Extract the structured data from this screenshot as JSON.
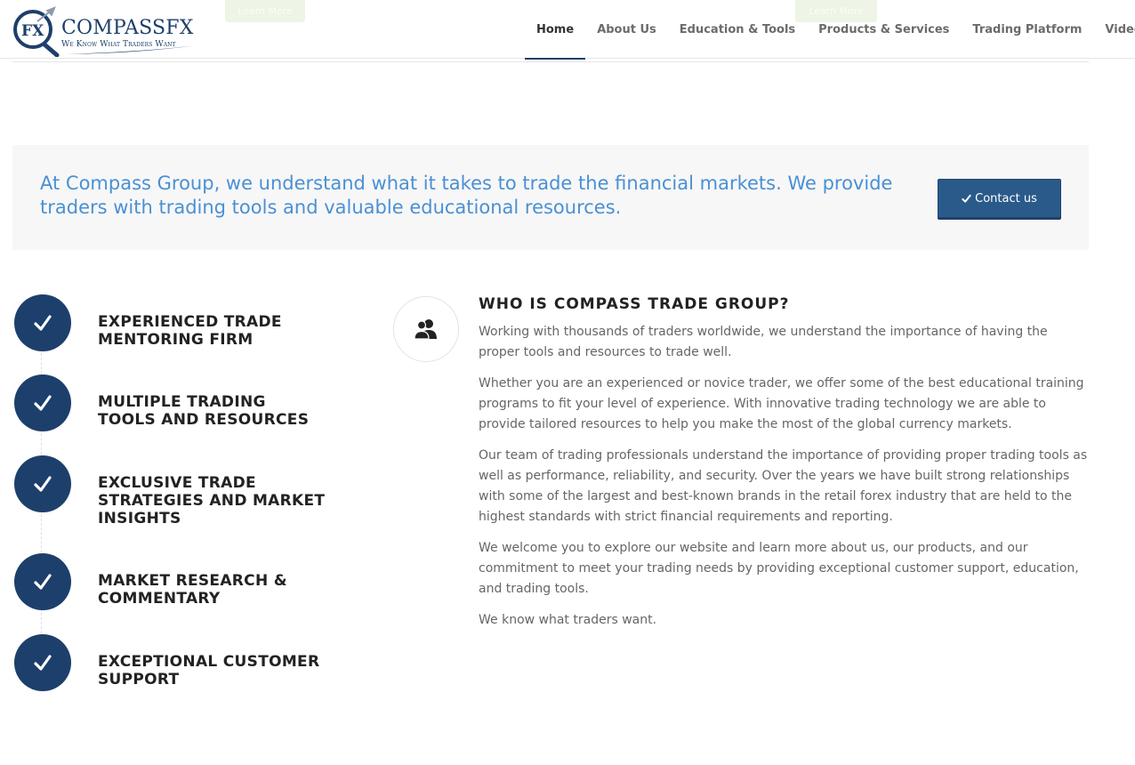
{
  "header": {
    "logo": {
      "mark_text": "FX",
      "name_part1": "Compass",
      "name_part2": "FX",
      "tagline": "We Know What Traders Want"
    },
    "ghost_buttons": [
      "Learn More",
      "Learn More"
    ],
    "nav": [
      {
        "label": "Home",
        "active": true
      },
      {
        "label": "About Us",
        "active": false
      },
      {
        "label": "Education & Tools",
        "active": false
      },
      {
        "label": "Products & Services",
        "active": false
      },
      {
        "label": "Trading Platform",
        "active": false
      },
      {
        "label": "Videos",
        "active": false
      }
    ]
  },
  "banner": {
    "text": "At Compass Group, we understand what it takes to trade the financial markets. We provide traders with trading tools and valuable educational resources.",
    "contact_label": "Contact us",
    "contact_icon": "check-icon"
  },
  "features": [
    {
      "label": "Experienced Trade Mentoring Firm",
      "icon": "check-icon"
    },
    {
      "label": "Multiple Trading Tools and Resources",
      "icon": "check-icon"
    },
    {
      "label": "Exclusive Trade Strategies and Market Insights",
      "icon": "check-icon"
    },
    {
      "label": "Market Research & Commentary",
      "icon": "check-icon"
    },
    {
      "label": "Exceptional Customer Support",
      "icon": "check-icon"
    }
  ],
  "about": {
    "icon": "people-icon",
    "title": "WHO IS COMPASS TRADE GROUP?",
    "paragraphs": [
      "Working with thousands of traders worldwide, we understand the importance of having the proper tools and resources to trade well.",
      "Whether you are an experienced or novice trader, we offer some of the best educational training programs to fit your level of experience.  With innovative trading technology we are able to provide tailored resources to help you make the most of the global currency markets.",
      "Our team of trading professionals understand the importance of providing proper trading tools as well as performance, reliability, and security. Over the years we have built strong relationships with some of the largest and best-known brands in the retail forex industry that are held to the highest standards with strict financial requirements and reporting.",
      "We welcome you to explore our website and learn more about us, our products, and our commitment to meet your trading needs by providing exceptional customer support, education, and trading tools.",
      "We know what traders want."
    ]
  },
  "colors": {
    "brand_navy": "#1d3f6b",
    "banner_text": "#4a90d4",
    "contact_button": "#2a5a8a",
    "banner_bg": "#f7f7f7"
  }
}
